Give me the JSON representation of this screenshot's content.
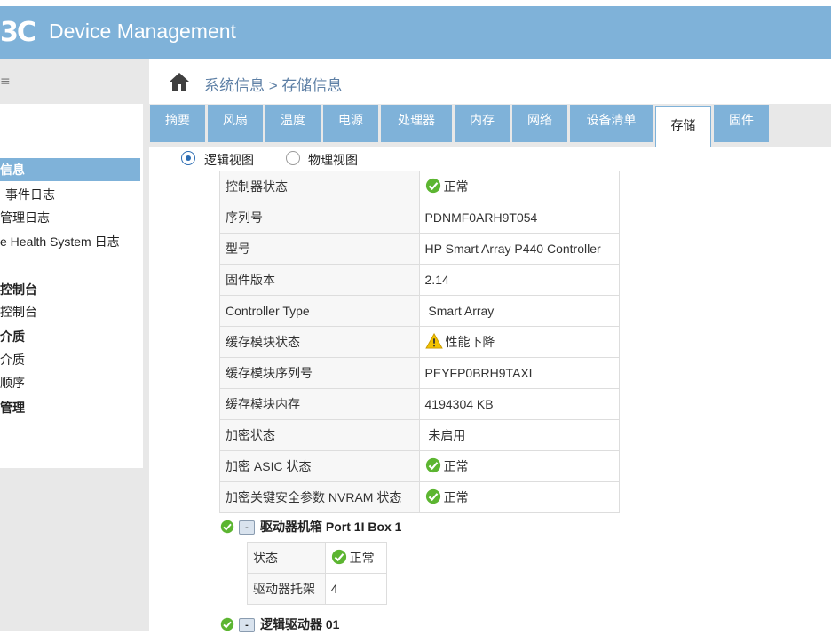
{
  "header": {
    "logo": "3C",
    "title": "Device Management"
  },
  "sidebar": {
    "top_text": "≡",
    "items": [
      {
        "label": "信息",
        "style": "active"
      },
      {
        "label": "事件日志",
        "style": "normal"
      },
      {
        "label": "管理日志",
        "style": "normal"
      },
      {
        "label": "e Health System 日志",
        "style": "normal"
      },
      {
        "label": "控制台",
        "style": "bold"
      },
      {
        "label": "控制台",
        "style": "normal"
      },
      {
        "label": "介质",
        "style": "bold"
      },
      {
        "label": "介质",
        "style": "normal"
      },
      {
        "label": "顺序",
        "style": "normal"
      },
      {
        "label": "管理",
        "style": "bold"
      }
    ]
  },
  "breadcrumb": {
    "text": "系统信息 > 存储信息",
    "icon": "home-icon"
  },
  "tabs": [
    {
      "label": "摘要",
      "active": false
    },
    {
      "label": "风扇",
      "active": false
    },
    {
      "label": "温度",
      "active": false
    },
    {
      "label": "电源",
      "active": false
    },
    {
      "label": "处理器",
      "active": false
    },
    {
      "label": "内存",
      "active": false
    },
    {
      "label": "网络",
      "active": false
    },
    {
      "label": "设备清单",
      "active": false
    },
    {
      "label": "存储",
      "active": true
    },
    {
      "label": "固件",
      "active": false
    }
  ],
  "view_options": {
    "logical": {
      "label": "逻辑视图",
      "checked": true
    },
    "physical": {
      "label": "物理视图",
      "checked": false
    }
  },
  "controller_table": [
    {
      "label": "控制器状态",
      "value": "正常",
      "icon": "ok-icon"
    },
    {
      "label": "序列号",
      "value": "PDNMF0ARH9T054",
      "icon": ""
    },
    {
      "label": "型号",
      "value": "HP Smart Array P440 Controller",
      "icon": ""
    },
    {
      "label": "固件版本",
      "value": "2.14",
      "icon": ""
    },
    {
      "label": "Controller Type",
      "value": " Smart Array",
      "icon": ""
    },
    {
      "label": "缓存模块状态",
      "value": "性能下降",
      "icon": "warn-icon"
    },
    {
      "label": "缓存模块序列号",
      "value": "PEYFP0BRH9TAXL",
      "icon": ""
    },
    {
      "label": "缓存模块内存",
      "value": "4194304 KB",
      "icon": ""
    },
    {
      "label": "加密状态",
      "value": " 未启用",
      "icon": ""
    },
    {
      "label": "加密 ASIC 状态",
      "value": "正常",
      "icon": "ok-icon"
    },
    {
      "label": "加密关键安全参数 NVRAM 状态",
      "value": "正常",
      "icon": "ok-icon"
    }
  ],
  "drive_enclosure": {
    "title": "驱动器机箱 Port 1I Box 1",
    "collapse_symbol": "-",
    "rows": [
      {
        "label": "状态",
        "value": "正常",
        "icon": "ok-icon"
      },
      {
        "label": "驱动器托架",
        "value": "4",
        "icon": ""
      }
    ]
  },
  "logical_drive": {
    "title": "逻辑驱动器 01",
    "collapse_symbol": "-"
  },
  "colors": {
    "header_bg": "#7fb2d9",
    "tab_bg": "#7fb2d9",
    "ok_green": "#5cb531",
    "warn_yellow": "#f2c200",
    "link_blue": "#5d7fa5"
  }
}
